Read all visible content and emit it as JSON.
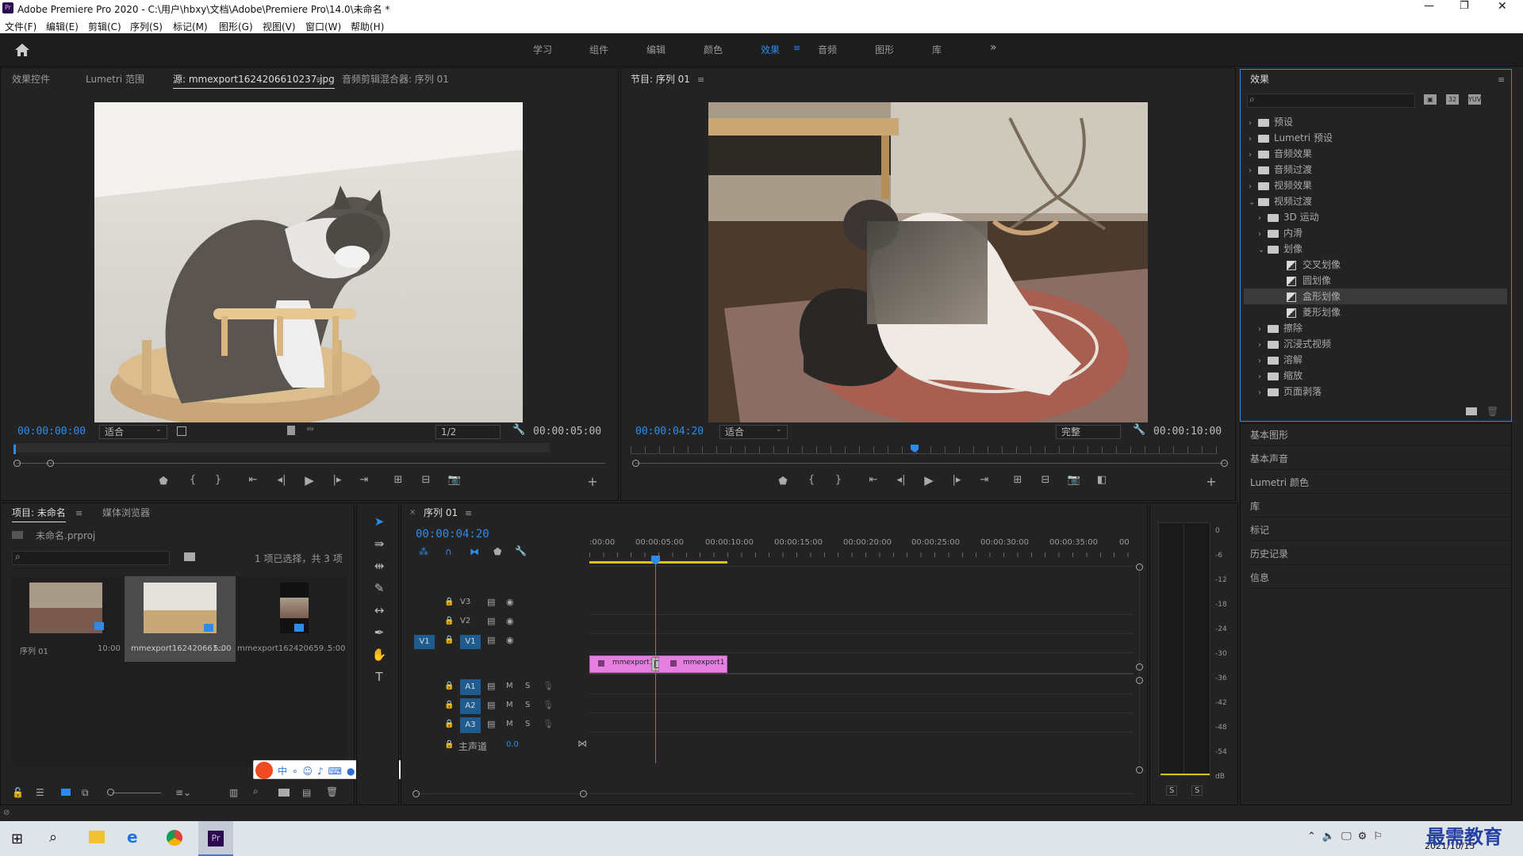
{
  "window": {
    "title": "Adobe Premiere Pro 2020 - C:\\用户\\hbxy\\文档\\Adobe\\Premiere Pro\\14.0\\未命名 *",
    "app_icon": "Pr"
  },
  "menu": [
    "文件(F)",
    "编辑(E)",
    "剪辑(C)",
    "序列(S)",
    "标记(M)",
    "图形(G)",
    "视图(V)",
    "窗口(W)",
    "帮助(H)"
  ],
  "workspaces": [
    "学习",
    "组件",
    "编辑",
    "颜色",
    "效果",
    "音频",
    "图形",
    "库"
  ],
  "active_workspace": "效果",
  "source_panel": {
    "tabs": [
      "效果控件",
      "Lumetri 范围",
      "源: mmexport1624206610237.jpg",
      "音频剪辑混合器: 序列 01"
    ],
    "timecode_in": "00:00:00:00",
    "timecode_out": "00:00:05:00",
    "fit": "适合",
    "resolution": "1/2"
  },
  "program_panel": {
    "title": "节目: 序列 01",
    "timecode": "00:00:04:20",
    "duration": "00:00:10:00",
    "fit": "适合",
    "quality": "完整"
  },
  "effects_panel": {
    "title": "效果",
    "tree": [
      {
        "label": "预设",
        "level": 0,
        "open": false
      },
      {
        "label": "Lumetri 预设",
        "level": 0,
        "open": false
      },
      {
        "label": "音频效果",
        "level": 0,
        "open": false
      },
      {
        "label": "音频过渡",
        "level": 0,
        "open": false
      },
      {
        "label": "视频效果",
        "level": 0,
        "open": false
      },
      {
        "label": "视频过渡",
        "level": 0,
        "open": true
      },
      {
        "label": "3D 运动",
        "level": 1,
        "open": false
      },
      {
        "label": "内滑",
        "level": 1,
        "open": false
      },
      {
        "label": "划像",
        "level": 1,
        "open": true
      },
      {
        "label": "交叉划像",
        "level": 2,
        "effect": true
      },
      {
        "label": "圆划像",
        "level": 2,
        "effect": true
      },
      {
        "label": "盒形划像",
        "level": 2,
        "effect": true,
        "selected": true
      },
      {
        "label": "菱形划像",
        "level": 2,
        "effect": true
      },
      {
        "label": "擦除",
        "level": 1,
        "open": false
      },
      {
        "label": "沉浸式视频",
        "level": 1,
        "open": false
      },
      {
        "label": "溶解",
        "level": 1,
        "open": false
      },
      {
        "label": "缩放",
        "level": 1,
        "open": false
      },
      {
        "label": "页面剥落",
        "level": 1,
        "open": false
      }
    ]
  },
  "side_panels": [
    "基本图形",
    "基本声音",
    "Lumetri 颜色",
    "库",
    "标记",
    "历史记录",
    "信息"
  ],
  "project_panel": {
    "tabs": [
      "项目: 未命名",
      "媒体浏览器"
    ],
    "file": "未命名.prproj",
    "status": "1 项已选择，共 3 项",
    "items": [
      {
        "name": "序列 01",
        "duration": "10:00"
      },
      {
        "name": "mmexport162420661...",
        "duration": "5:00"
      },
      {
        "name": "mmexport162420659...",
        "duration": "5:00"
      }
    ]
  },
  "timeline": {
    "tab": "序列 01",
    "timecode": "00:00:04:20",
    "ruler": [
      ":00:00",
      "00:00:05:00",
      "00:00:10:00",
      "00:00:15:00",
      "00:00:20:00",
      "00:00:25:00",
      "00:00:30:00",
      "00:00:35:00",
      "00"
    ],
    "video_tracks": [
      "V3",
      "V2",
      "V1"
    ],
    "audio_tracks": [
      "A1",
      "A2",
      "A3"
    ],
    "master": "主声道",
    "master_value": "0.0",
    "clips": [
      "mmexport1",
      "mmexport1"
    ],
    "mute": "M",
    "solo": "S"
  },
  "meter": {
    "scale": [
      "0",
      "-6",
      "-12",
      "-18",
      "-24",
      "-30",
      "-36",
      "-42",
      "-48",
      "-54",
      "dB"
    ],
    "solo": [
      "S",
      "S"
    ]
  },
  "taskbar": {
    "date": "2021/10/15",
    "watermark": "最需教育"
  }
}
